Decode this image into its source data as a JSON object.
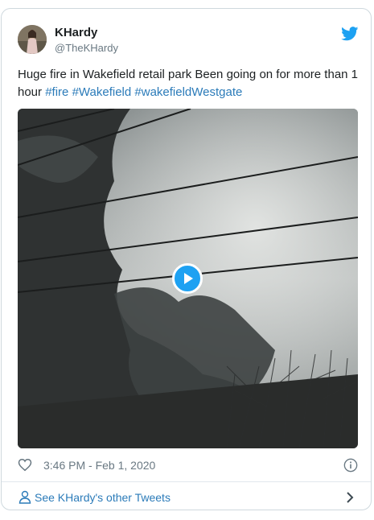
{
  "tweet": {
    "author_name": "KHardy",
    "author_handle": "@TheKHardy",
    "text_plain": "Huge fire in Wakefield retail park Been going on for more than 1 hour ",
    "hashtags": [
      "#fire",
      "#Wakefield",
      "#wakefieldWestgate"
    ],
    "timestamp": "3:46 PM - Feb 1, 2020"
  },
  "footer": {
    "more_tweets_label": "See KHardy's other Tweets"
  },
  "icons": {
    "brand": "twitter-bird-icon",
    "like": "heart-icon",
    "info": "info-icon",
    "profile": "person-icon",
    "chevron": "chevron-right-icon",
    "play": "play-icon"
  },
  "colors": {
    "accent": "#1da1f2",
    "link": "#2b7bb9",
    "muted": "#697882"
  }
}
